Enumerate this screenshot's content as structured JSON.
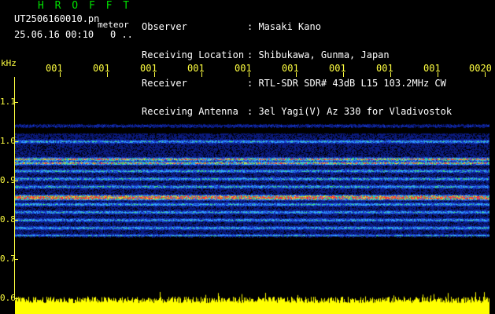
{
  "header": {
    "app_title": "H R O F F T",
    "file_name": "UT2506160010.pn",
    "meteor_label": "meteor",
    "datetime": "25.06.16 00:10",
    "scale_text": "0 .."
  },
  "station": [
    {
      "key": "Observer",
      "value": ": Masaki Kano"
    },
    {
      "key": "Receiving Location",
      "value": ": Shibukawa, Gunma, Japan"
    },
    {
      "key": "Receiver",
      "value": ": RTL-SDR SDR# 43dB L15 103.2MHz CW"
    },
    {
      "key": "Receiving Antenna",
      "value": ": 3el Yagi(V) Az 330 for Vladivostok"
    }
  ],
  "chart_data": {
    "type": "heatmap",
    "ylabel": "kHz",
    "y_ticks": [
      "1.1",
      "1.0",
      "0.9",
      "0.8",
      "0.7",
      "0.6"
    ],
    "x_ticks": [
      "001",
      "001",
      "001",
      "001",
      "001",
      "001",
      "001",
      "001",
      "001",
      "0020"
    ],
    "ylim": [
      0.6,
      1.15
    ],
    "bands_khz": [
      0.955,
      0.945,
      0.925,
      0.905,
      0.885,
      0.86,
      0.855,
      0.84,
      0.82,
      0.8,
      0.78,
      0.76,
      1.0,
      1.04
    ],
    "colors": {
      "axis": "#ffff40",
      "title": "#00e000",
      "text": "#ffffff",
      "counter": "#ffff00",
      "noise": "#1020a0"
    }
  }
}
